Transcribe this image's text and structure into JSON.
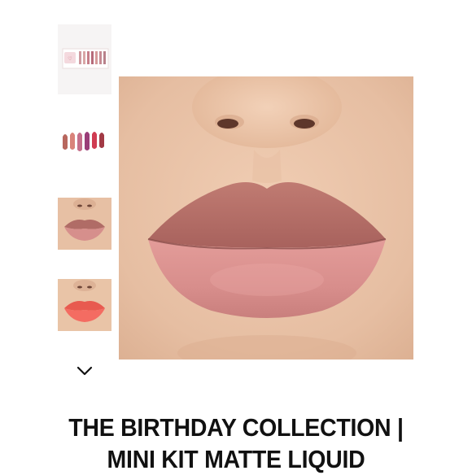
{
  "gallery": {
    "thumbnails": [
      {
        "name": "kit-box-thumbnail",
        "selected": false
      },
      {
        "name": "swatches-thumbnail",
        "selected": false
      },
      {
        "name": "nude-lips-thumbnail",
        "selected": true
      },
      {
        "name": "coral-lips-thumbnail",
        "selected": false
      }
    ],
    "scroll_icon": "chevron-down-icon",
    "main_image": "nude-matte-lips-photo"
  },
  "product": {
    "title": "THE BIRTHDAY COLLECTION | MINI KIT MATTE LIQUID"
  },
  "colors": {
    "skin": "#e8c2a6",
    "lip_upper": "#b96f68",
    "lip_lower": "#d88e8c",
    "coral": "#f0655a",
    "title": "#111111"
  }
}
